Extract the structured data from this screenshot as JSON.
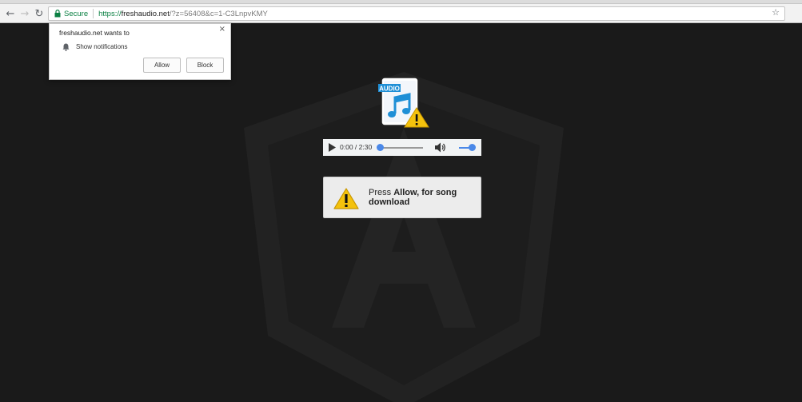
{
  "browser": {
    "secure_label": "Secure",
    "url_proto": "https://",
    "url_host": "freshaudio.net",
    "url_rest": "/?z=56408&c=1-C3LnpvKMY"
  },
  "notification_popup": {
    "title": "freshaudio.net wants to",
    "permission": "Show notifications",
    "allow_label": "Allow",
    "block_label": "Block"
  },
  "player": {
    "time": "0:00 / 2:30",
    "progress": 0,
    "volume": 1
  },
  "icon_badge": "AUDIO",
  "notice": {
    "prefix": "Press ",
    "bold": "Allow, for song download"
  },
  "colors": {
    "secure_green": "#0b8043",
    "accent_blue": "#4a88e8",
    "warning_yellow": "#f4c20d"
  }
}
